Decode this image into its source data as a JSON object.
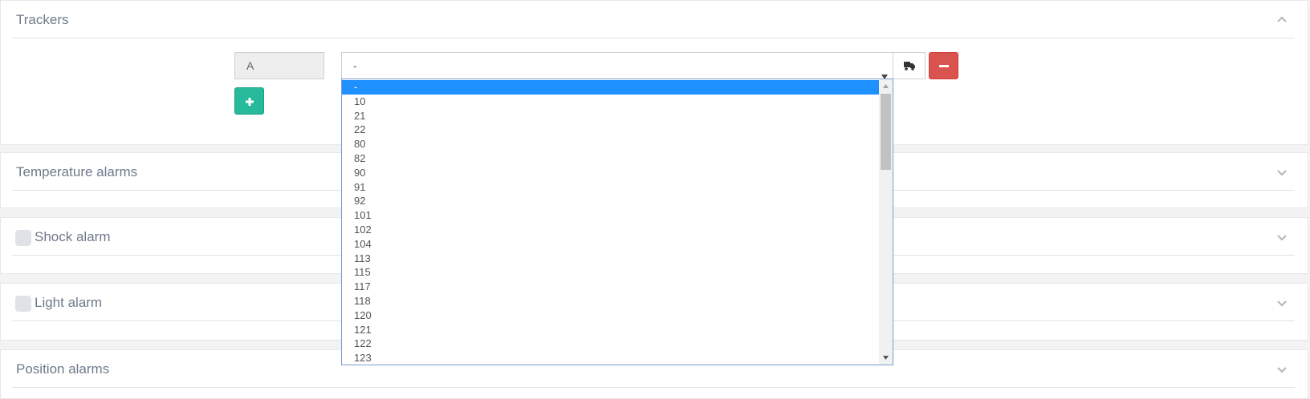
{
  "sections": {
    "trackers": {
      "title": "Trackers"
    },
    "temperature": {
      "title": "Temperature alarms"
    },
    "shock": {
      "title": "Shock alarm"
    },
    "light": {
      "title": "Light alarm"
    },
    "position": {
      "title": "Position alarms"
    }
  },
  "tracker_row": {
    "letter": "A",
    "selected_value": "-"
  },
  "dropdown": {
    "options": [
      "-",
      "10",
      "21",
      "22",
      "80",
      "82",
      "90",
      "91",
      "92",
      "101",
      "102",
      "104",
      "113",
      "115",
      "117",
      "118",
      "120",
      "121",
      "122",
      "123"
    ],
    "selected_index": 0
  },
  "colors": {
    "add_button": "#26b99a",
    "remove_button": "#d9534f",
    "selected_option": "#1e90ff",
    "section_title": "#6e7a8a"
  },
  "icons": {
    "add": "plus-icon",
    "truck": "truck-icon",
    "remove": "minus-icon",
    "section_expanded": "chevron-up-icon",
    "section_collapsed": "chevron-down-icon"
  }
}
